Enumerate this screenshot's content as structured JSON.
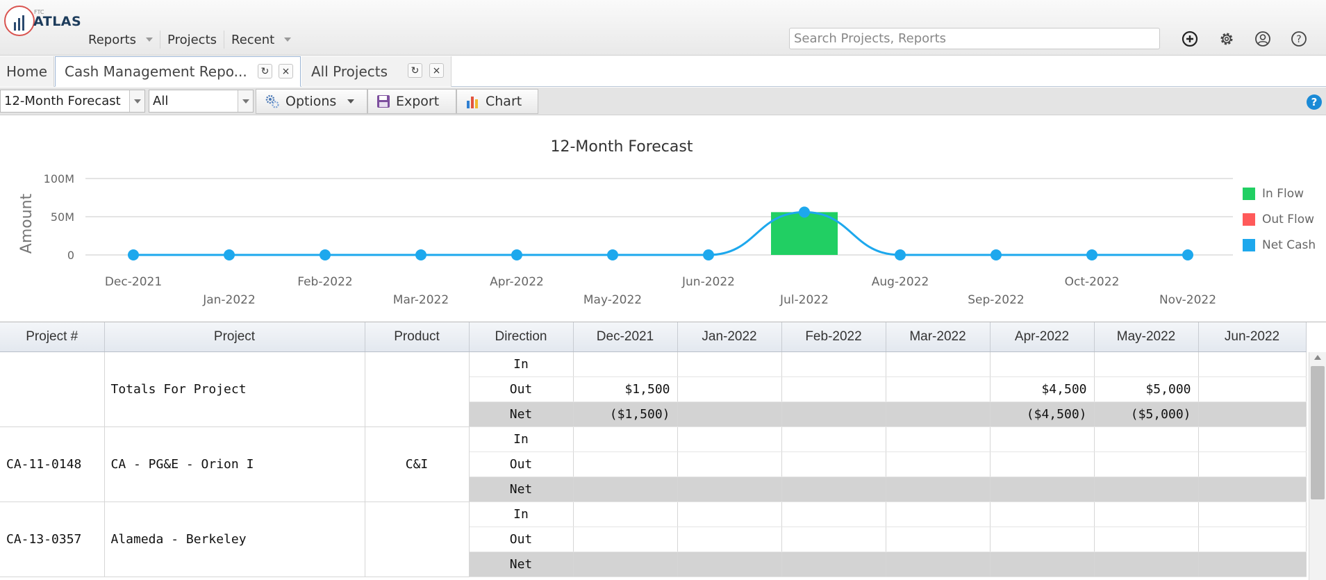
{
  "app": {
    "logo_small": "FTC",
    "logo_text": "ATLAS"
  },
  "nav": {
    "items": [
      {
        "label": "Reports"
      },
      {
        "label": "Projects"
      },
      {
        "label": "Recent"
      }
    ]
  },
  "search": {
    "placeholder": "Search Projects, Reports",
    "value": ""
  },
  "header_icons": [
    "add-icon",
    "gear-icon",
    "user-icon",
    "help-icon"
  ],
  "tabs": [
    {
      "label": "Home"
    },
    {
      "label": "Cash Management Repo..."
    },
    {
      "label": "All Projects"
    }
  ],
  "toolbar": {
    "report_select": "12-Month Forecast",
    "filter_select": "All",
    "options_label": "Options",
    "export_label": "Export",
    "chart_label": "Chart",
    "help_label": "?"
  },
  "chart_data": {
    "type": "bar",
    "title": "12-Month Forecast",
    "ylabel": "Amount",
    "xlabel": "",
    "ylim": [
      0,
      100000000
    ],
    "yticks": [
      "0",
      "50M",
      "100M"
    ],
    "categories": [
      "Dec-2021",
      "Jan-2022",
      "Feb-2022",
      "Mar-2022",
      "Apr-2022",
      "May-2022",
      "Jun-2022",
      "Jul-2022",
      "Aug-2022",
      "Sep-2022",
      "Oct-2022",
      "Nov-2022"
    ],
    "series": [
      {
        "name": "In Flow",
        "type": "bar",
        "color": "#21cf63",
        "values": [
          0,
          0,
          0,
          0,
          0,
          0,
          0,
          56000000,
          0,
          0,
          0,
          0
        ]
      },
      {
        "name": "Out Flow",
        "type": "bar",
        "color": "#ff5a5a",
        "values": [
          1500,
          0,
          0,
          0,
          4500,
          5000,
          0,
          0,
          0,
          0,
          0,
          0
        ]
      },
      {
        "name": "Net Cash",
        "type": "line",
        "color": "#1da8ed",
        "values": [
          -1500,
          0,
          0,
          0,
          -4500,
          -5000,
          0,
          56000000,
          0,
          0,
          0,
          0
        ]
      }
    ],
    "legend_position": "right",
    "grid": true
  },
  "grid": {
    "columns": [
      "Project #",
      "Project",
      "Product",
      "Direction",
      "Dec-2021",
      "Jan-2022",
      "Feb-2022",
      "Mar-2022",
      "Apr-2022",
      "May-2022",
      "Jun-2022"
    ],
    "groups": [
      {
        "project_no": "",
        "project": "Totals For Project",
        "product": "",
        "rows": [
          {
            "direction": "In",
            "values": [
              "",
              "",
              "",
              "",
              "",
              "",
              ""
            ]
          },
          {
            "direction": "Out",
            "values": [
              "$1,500",
              "",
              "",
              "",
              "$4,500",
              "$5,000",
              ""
            ]
          },
          {
            "direction": "Net",
            "values": [
              "($1,500)",
              "",
              "",
              "",
              "($4,500)",
              "($5,000)",
              ""
            ]
          }
        ]
      },
      {
        "project_no": "CA-11-0148",
        "project": "CA - PG&E - Orion I",
        "product": "C&I",
        "rows": [
          {
            "direction": "In",
            "values": [
              "",
              "",
              "",
              "",
              "",
              "",
              ""
            ]
          },
          {
            "direction": "Out",
            "values": [
              "",
              "",
              "",
              "",
              "",
              "",
              ""
            ]
          },
          {
            "direction": "Net",
            "values": [
              "",
              "",
              "",
              "",
              "",
              "",
              ""
            ]
          }
        ]
      },
      {
        "project_no": "CA-13-0357",
        "project": "Alameda - Berkeley",
        "product": "",
        "rows": [
          {
            "direction": "In",
            "values": [
              "",
              "",
              "",
              "",
              "",
              "",
              ""
            ]
          },
          {
            "direction": "Out",
            "values": [
              "",
              "",
              "",
              "",
              "",
              "",
              ""
            ]
          },
          {
            "direction": "Net",
            "values": [
              "",
              "",
              "",
              "",
              "",
              "",
              ""
            ]
          }
        ]
      }
    ]
  }
}
